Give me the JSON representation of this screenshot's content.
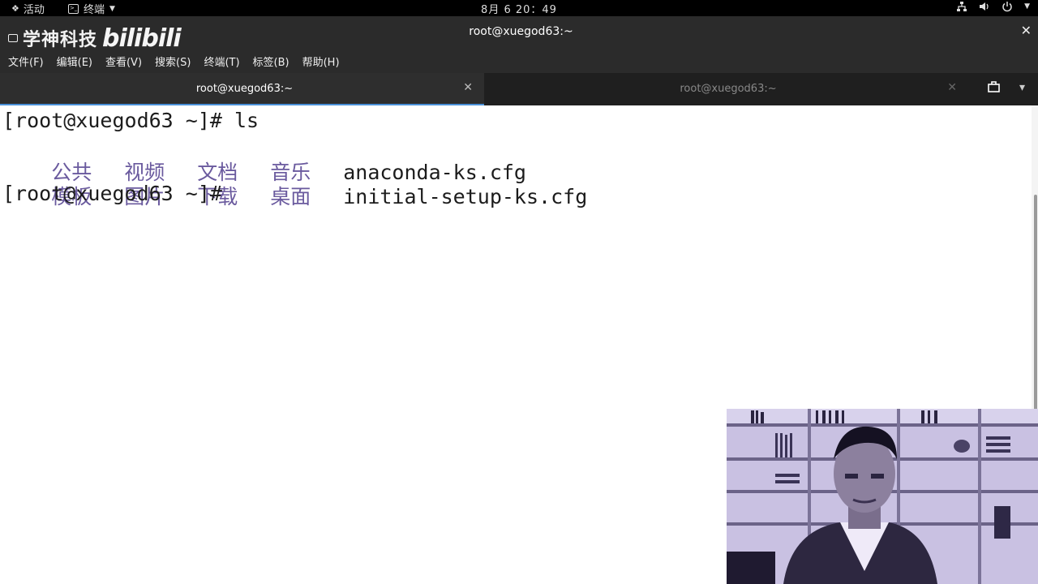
{
  "topbar": {
    "activities": "活动",
    "app_menu": "终端",
    "clock": "8月 6  20：49"
  },
  "window": {
    "title": "root@xuegod63:~",
    "watermark_brand": "学神科技",
    "watermark_site": "bilibili"
  },
  "menu": [
    "文件(F)",
    "编辑(E)",
    "查看(V)",
    "搜索(S)",
    "终端(T)",
    "标签(B)",
    "帮助(H)"
  ],
  "tabs": [
    {
      "label": "root@xuegod63:~",
      "active": true
    },
    {
      "label": "root@xuegod63:~",
      "active": false
    }
  ],
  "terminal": {
    "prompt1": "[root@xuegod63 ~]# ls",
    "row1_dirs": [
      "公共",
      "视频",
      "文档",
      "音乐"
    ],
    "row1_file": "anaconda-ks.cfg",
    "row2_dirs": [
      "模板",
      "图片",
      "下载",
      "桌面"
    ],
    "row2_file": "initial-setup-ks.cfg",
    "prompt2": "[root@xuegod63 ~]#"
  },
  "colors": {
    "dir_text": "#6a5a9e",
    "tab_accent": "#4a90d9",
    "webcam_tint": "#c7bfe0"
  }
}
